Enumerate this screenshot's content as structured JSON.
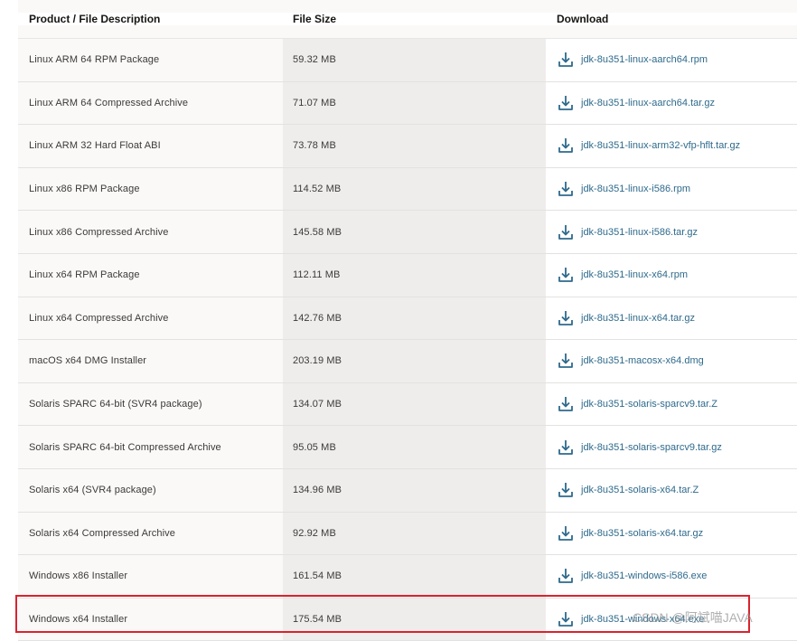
{
  "table": {
    "headers": {
      "product": "Product / File Description",
      "size": "File Size",
      "download": "Download"
    },
    "rows": [
      {
        "product": "Linux ARM 64 RPM Package",
        "size": "59.32 MB",
        "file": "jdk-8u351-linux-aarch64.rpm"
      },
      {
        "product": "Linux ARM 64 Compressed Archive",
        "size": "71.07 MB",
        "file": "jdk-8u351-linux-aarch64.tar.gz"
      },
      {
        "product": "Linux ARM 32 Hard Float ABI",
        "size": "73.78 MB",
        "file": "jdk-8u351-linux-arm32-vfp-hflt.tar.gz"
      },
      {
        "product": "Linux x86 RPM Package",
        "size": "114.52 MB",
        "file": "jdk-8u351-linux-i586.rpm"
      },
      {
        "product": "Linux x86 Compressed Archive",
        "size": "145.58 MB",
        "file": "jdk-8u351-linux-i586.tar.gz"
      },
      {
        "product": "Linux x64 RPM Package",
        "size": "112.11 MB",
        "file": "jdk-8u351-linux-x64.rpm"
      },
      {
        "product": "Linux x64 Compressed Archive",
        "size": "142.76 MB",
        "file": "jdk-8u351-linux-x64.tar.gz"
      },
      {
        "product": "macOS x64 DMG Installer",
        "size": "203.19 MB",
        "file": "jdk-8u351-macosx-x64.dmg"
      },
      {
        "product": "Solaris SPARC 64-bit (SVR4 package)",
        "size": "134.07 MB",
        "file": "jdk-8u351-solaris-sparcv9.tar.Z"
      },
      {
        "product": "Solaris SPARC 64-bit Compressed Archive",
        "size": "95.05 MB",
        "file": "jdk-8u351-solaris-sparcv9.tar.gz"
      },
      {
        "product": "Solaris x64 (SVR4 package)",
        "size": "134.96 MB",
        "file": "jdk-8u351-solaris-x64.tar.Z"
      },
      {
        "product": "Solaris x64 Compressed Archive",
        "size": "92.92 MB",
        "file": "jdk-8u351-solaris-x64.tar.gz"
      },
      {
        "product": "Windows x86 Installer",
        "size": "161.54 MB",
        "file": "jdk-8u351-windows-i586.exe"
      },
      {
        "product": "Windows x64 Installer",
        "size": "175.54 MB",
        "file": "jdk-8u351-windows-x64.exe"
      }
    ]
  },
  "icons": {
    "download": "download-icon"
  },
  "colors": {
    "link": "#2e6a8c",
    "highlight": "#d9232e"
  },
  "watermark": "CSDN @阿斌喵JAVA"
}
